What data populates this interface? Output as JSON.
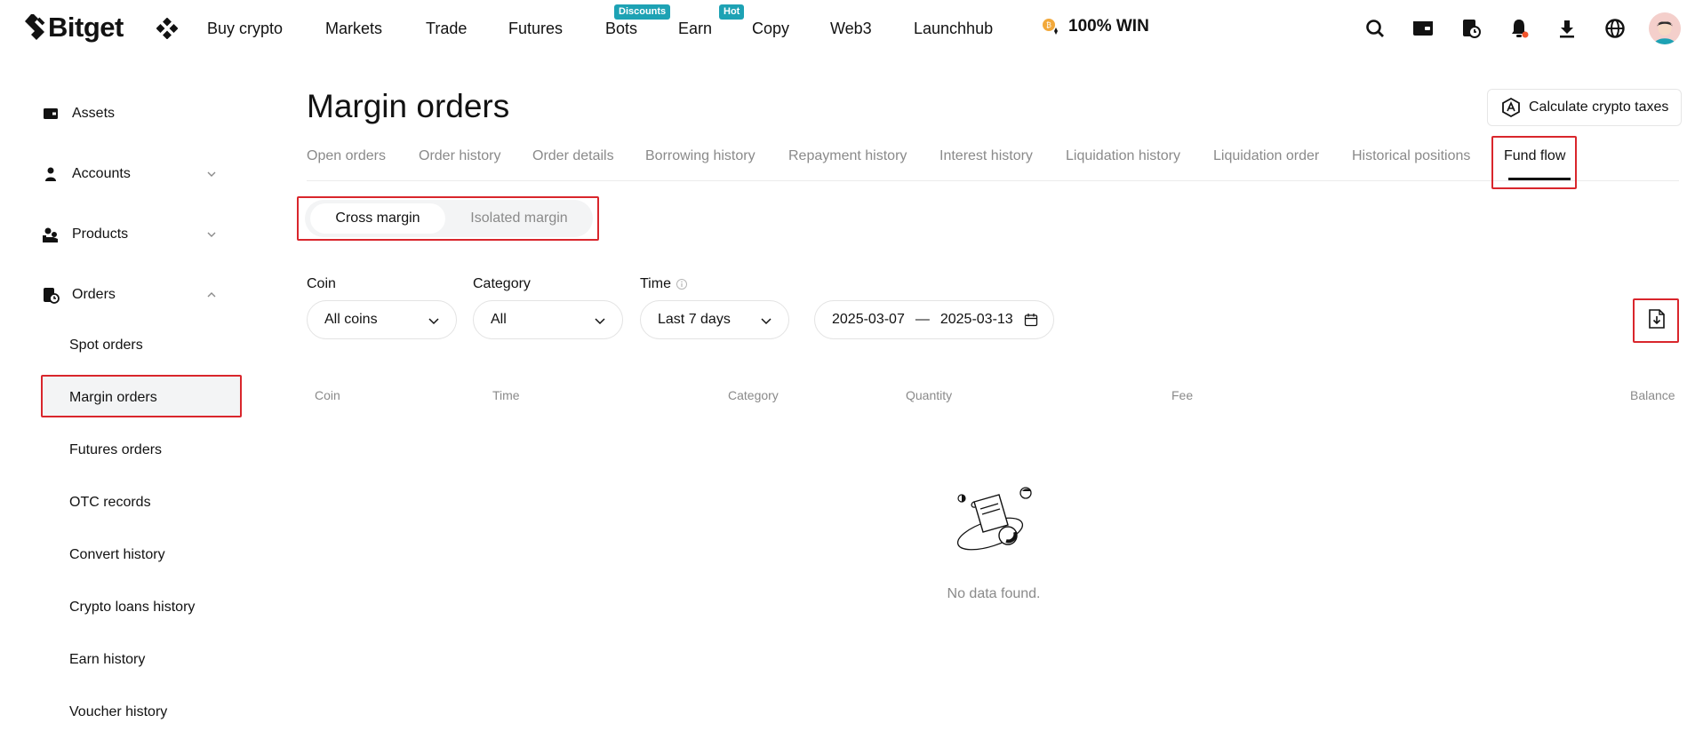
{
  "brand": {
    "name": "Bitget",
    "accent": "#121212",
    "badge_color": "#1da2b4",
    "highlight_color": "#d9262c"
  },
  "topnav": {
    "items": [
      {
        "label": "Buy crypto"
      },
      {
        "label": "Markets"
      },
      {
        "label": "Trade"
      },
      {
        "label": "Futures"
      },
      {
        "label": "Bots",
        "badge": "Discounts"
      },
      {
        "label": "Earn",
        "badge": "Hot"
      },
      {
        "label": "Copy"
      },
      {
        "label": "Web3"
      },
      {
        "label": "Launchhub"
      }
    ],
    "promo": "100% WIN",
    "icons": [
      "search-icon",
      "wallet-icon",
      "orders-icon",
      "bell-icon",
      "download-icon",
      "globe-icon",
      "avatar"
    ]
  },
  "sidebar": {
    "items": [
      {
        "label": "Assets",
        "icon": "wallet-icon"
      },
      {
        "label": "Accounts",
        "icon": "user-icon",
        "expanded": false
      },
      {
        "label": "Products",
        "icon": "products-icon",
        "expanded": false
      },
      {
        "label": "Orders",
        "icon": "orders-icon",
        "expanded": true
      }
    ],
    "order_subitems": [
      "Spot orders",
      "Margin orders",
      "Futures orders",
      "OTC records",
      "Convert history",
      "Crypto loans history",
      "Earn history",
      "Voucher history"
    ],
    "active_subitem": "Margin orders"
  },
  "main": {
    "title": "Margin orders",
    "tax_button": "Calculate crypto taxes",
    "tabs": [
      "Open orders",
      "Order history",
      "Order details",
      "Borrowing history",
      "Repayment history",
      "Interest history",
      "Liquidation history",
      "Liquidation order",
      "Historical positions",
      "Fund flow"
    ],
    "active_tab": "Fund flow",
    "margin_toggle": {
      "options": [
        "Cross margin",
        "Isolated margin"
      ],
      "selected": "Cross margin"
    },
    "filters": {
      "coin": {
        "label": "Coin",
        "value": "All coins"
      },
      "category": {
        "label": "Category",
        "value": "All"
      },
      "time": {
        "label": "Time",
        "value": "Last 7 days"
      },
      "date_from": "2025-03-07",
      "date_separator": "—",
      "date_to": "2025-03-13"
    },
    "table": {
      "columns": [
        "Coin",
        "Time",
        "Category",
        "Quantity",
        "Fee",
        "Balance"
      ],
      "rows": []
    },
    "empty_message": "No data found."
  }
}
